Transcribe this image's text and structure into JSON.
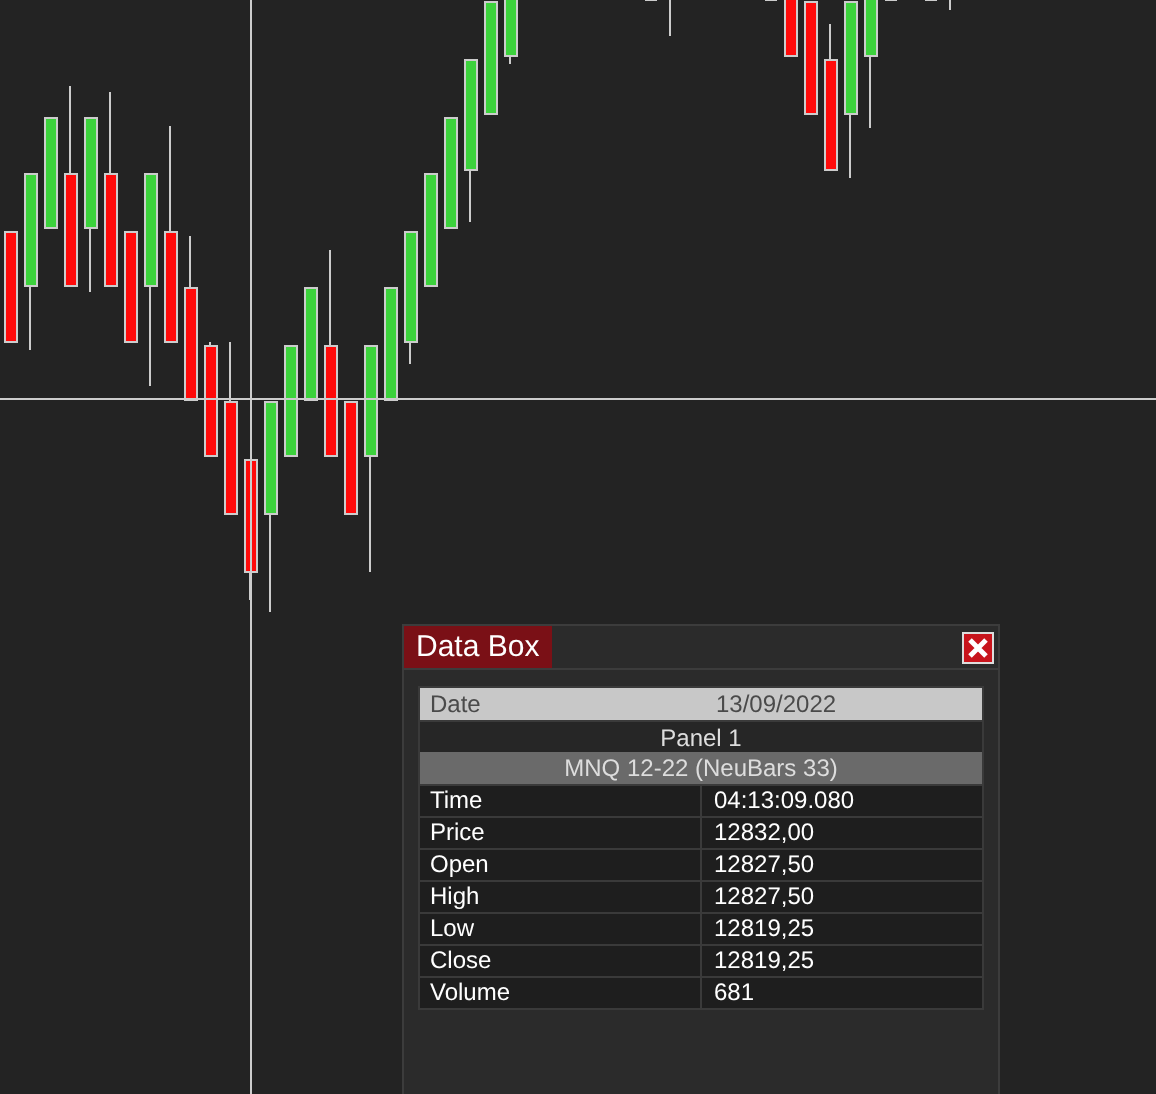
{
  "data_box": {
    "title": "Data Box",
    "date_label": "Date",
    "date_value": "13/09/2022",
    "panel": "Panel 1",
    "instrument": "MNQ 12-22 (NeuBars 33)",
    "rows": [
      {
        "label": "Time",
        "value": "04:13:09.080"
      },
      {
        "label": "Price",
        "value": "12832,00"
      },
      {
        "label": "Open",
        "value": "12827,50"
      },
      {
        "label": "High",
        "value": "12827,50"
      },
      {
        "label": "Low",
        "value": "12819,25"
      },
      {
        "label": "Close",
        "value": "12819,25"
      },
      {
        "label": "Volume",
        "value": "681"
      }
    ]
  }
}
